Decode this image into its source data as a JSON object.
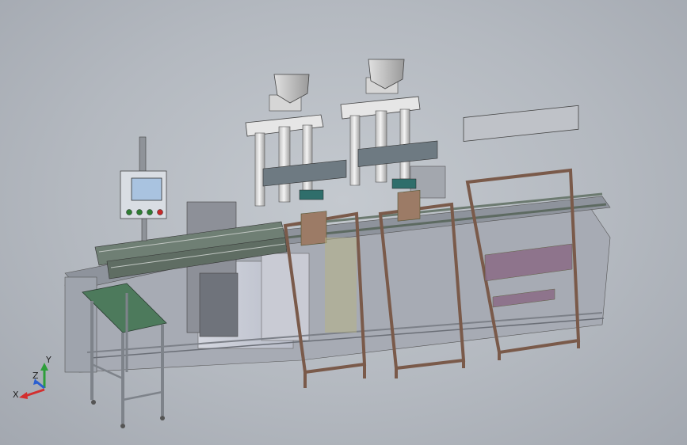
{
  "viewport": {
    "background_top": "#c4c9cf",
    "background_bottom": "#a3a8b0"
  },
  "model": {
    "frame_color": "#7a5a4a",
    "frame_highlight": "#9c7b66",
    "conveyor_color": "#6f7f74",
    "table_top_color": "#4d7a5c",
    "panel_color": "#c8cbd6",
    "tower_color": "#e6e6e6",
    "hopper_color": "#cfcfcf",
    "accent_purple": "#8a6b86",
    "hmi_box_color": "#d9dde3",
    "hmi_screen_color": "#a9c3e0",
    "button_colors": [
      "#2e7d32",
      "#2e7d32",
      "#2e7d32",
      "#c62828"
    ]
  },
  "triad": {
    "x_label": "X",
    "y_label": "Y",
    "z_label": "Z",
    "x_color": "#d32f2f",
    "y_color": "#2e9e3a",
    "z_color": "#2b5fd0"
  }
}
